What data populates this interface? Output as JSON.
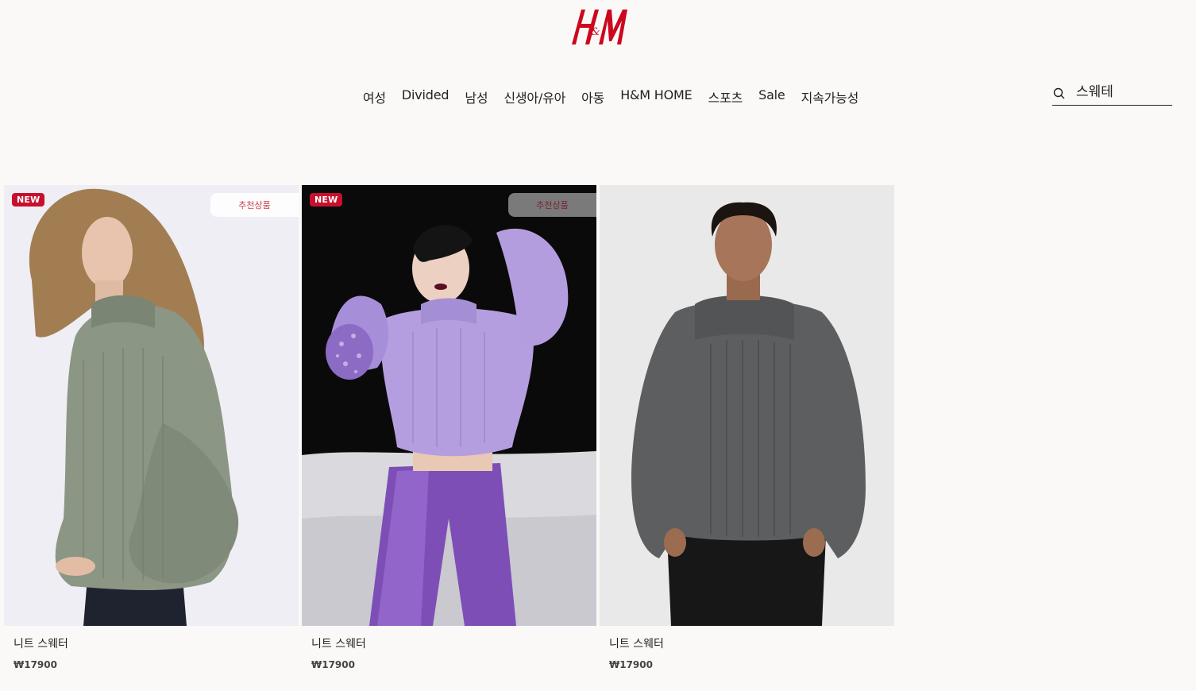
{
  "brand": {
    "logo_text": "H&M",
    "color": "#cc071e"
  },
  "nav": {
    "items": [
      "여성",
      "Divided",
      "남성",
      "신생아/유아",
      "아동",
      "H&M HOME",
      "스포츠",
      "Sale",
      "지속가능성"
    ]
  },
  "search": {
    "value": "스웨테",
    "icon": "search-icon"
  },
  "products": [
    {
      "badge_new": "NEW",
      "badge_rec": "추천상품",
      "title": "니트 스웨터",
      "price": "₩17900",
      "sweater_color": "#8b9684",
      "bg": "#eeeef3"
    },
    {
      "badge_new": "NEW",
      "badge_rec": "추천상품",
      "title": "니트 스웨터",
      "price": "₩17900",
      "sweater_color": "#b49ee0",
      "bg": "#0b0b0b"
    },
    {
      "title": "니트 스웨터",
      "price": "₩17900",
      "sweater_color": "#5d5e5f",
      "bg": "#eaeaea"
    }
  ]
}
